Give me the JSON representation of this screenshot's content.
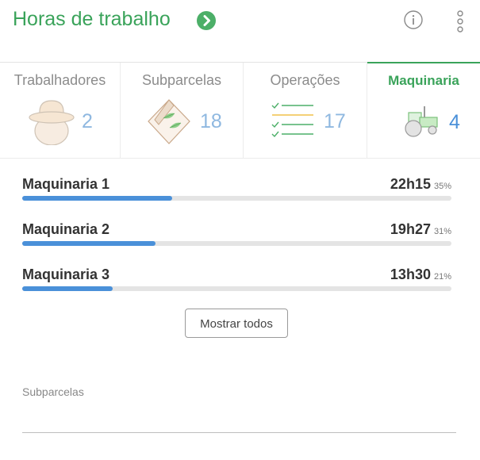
{
  "header": {
    "title": "Horas de trabalho",
    "go_icon": "chevron-right-circle-icon",
    "info_icon": "info-icon",
    "menu_icon": "more-vertical-icon"
  },
  "tabs": [
    {
      "label": "Trabalhadores",
      "count": "2",
      "icon": "worker-hat-icon",
      "active": false
    },
    {
      "label": "Subparcelas",
      "count": "18",
      "icon": "parcel-leaf-icon",
      "active": false
    },
    {
      "label": "Operações",
      "count": "17",
      "icon": "checklist-icon",
      "active": false
    },
    {
      "label": "Maquinaria",
      "count": "4",
      "icon": "tractor-icon",
      "active": true
    }
  ],
  "rows": [
    {
      "name": "Maquinaria 1",
      "value": "22h15",
      "percent": "35%",
      "fill": 0.35
    },
    {
      "name": "Maquinaria 2",
      "value": "19h27",
      "percent": "31%",
      "fill": 0.31
    },
    {
      "name": "Maquinaria 3",
      "value": "13h30",
      "percent": "21%",
      "fill": 0.21
    }
  ],
  "show_all_label": "Mostrar todos",
  "subparcels_label": "Subparcelas",
  "colors": {
    "accent_green": "#3aa35a",
    "bar_blue": "#4a90d9",
    "count_blue": "#8fb8e0"
  }
}
